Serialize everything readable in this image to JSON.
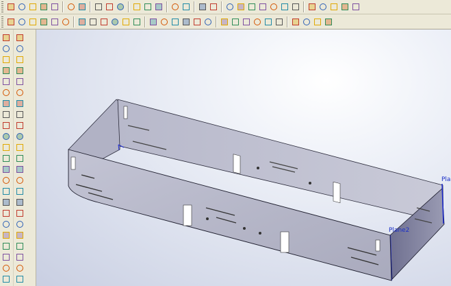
{
  "toolbar_top": {
    "icons": [
      "new-icon",
      "open-icon",
      "save-icon",
      "properties-icon",
      "print-icon",
      "undo-icon",
      "redo-icon",
      "select-icon",
      "select-other-icon",
      "rebuild-icon",
      "grid-icon",
      "sketch-icon",
      "3d-sketch-icon",
      "view-icon",
      "render-icon",
      "note-icon",
      "smart-dimension-icon",
      "zoom-fit-icon",
      "zoom-area-icon",
      "zoom-in-icon",
      "zoom-out-icon",
      "rotate-icon",
      "pan-icon",
      "view-orientation-icon",
      "wireframe-icon",
      "hidden-lines-icon",
      "hidden-removed-icon",
      "shaded-icon",
      "shaded-edges-icon"
    ]
  },
  "toolbar_second": {
    "icons": [
      "extrude-icon",
      "revolve-icon",
      "sweep-icon",
      "loft-icon",
      "fillet-icon",
      "chamfer-icon",
      "shell-icon",
      "rib-icon",
      "draft-icon",
      "hole-icon",
      "mirror-icon",
      "pattern-icon",
      "sheet-metal-icon",
      "base-flange-icon",
      "edge-flange-icon",
      "miter-flange-icon",
      "hem-icon",
      "jog-icon",
      "sketched-bend-icon",
      "closed-corner-icon",
      "unfold-icon",
      "fold-icon",
      "flatten-icon",
      "no-bends-icon",
      "rip-icon",
      "insert-bends-icon",
      "break-corner-icon",
      "forming-tool-icon"
    ]
  },
  "left_col1": {
    "icons": [
      "part-icon",
      "assembly-icon",
      "drawing-icon",
      "feature-icon",
      "boss-icon",
      "cut-icon",
      "fillet-icon",
      "plane-icon",
      "axis-icon",
      "point-icon",
      "curve-icon",
      "surface-icon",
      "reference-icon",
      "mate-icon",
      "component-icon",
      "explode-icon",
      "instant3d-icon",
      "feature-scope-icon",
      "move-face-icon",
      "split-icon",
      "combine-icon",
      "intersect-icon",
      "delete-body-icon"
    ]
  },
  "left_col2": {
    "icons": [
      "sketch-icon",
      "smart-dimension-icon",
      "line-icon",
      "rectangle-icon",
      "circle-icon",
      "arc-icon",
      "centerpoint-arc-icon",
      "tangent-arc-icon",
      "ellipse-icon",
      "spline-icon",
      "point-icon",
      "centerline-icon",
      "text-icon",
      "fillet-sketch-icon",
      "trim-icon",
      "extend-icon",
      "offset-icon",
      "mirror-sketch-icon",
      "linear-pattern-icon",
      "circular-pattern-icon",
      "move-entity-icon",
      "relations-icon",
      "repair-icon"
    ]
  },
  "viewport": {
    "plane_labels": [
      "Pla",
      "Plane2"
    ]
  }
}
